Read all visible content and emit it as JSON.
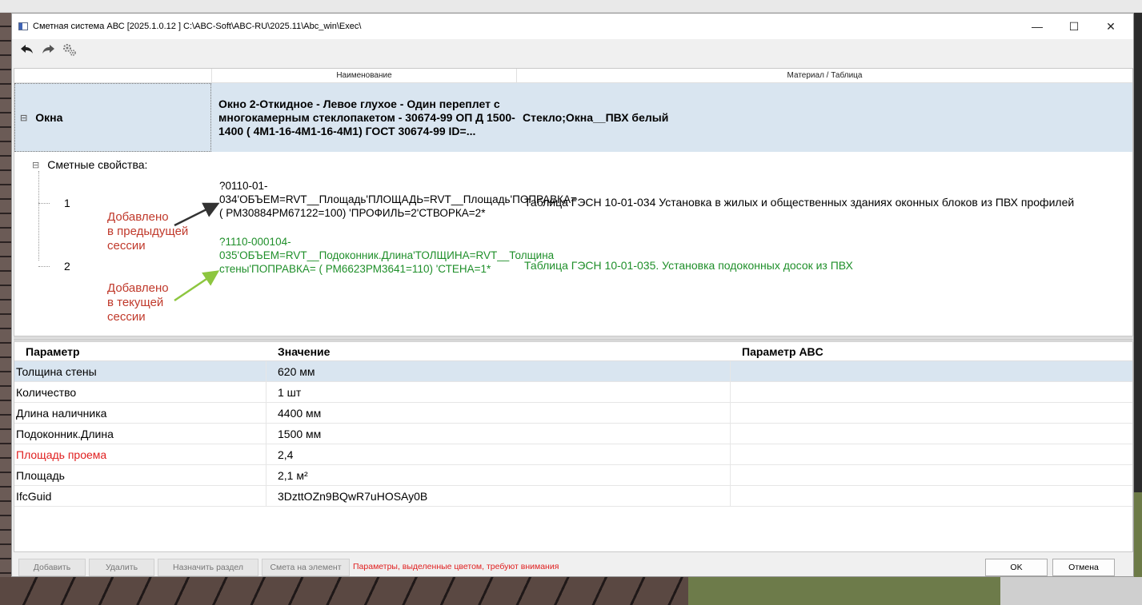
{
  "window": {
    "title": "Сметная система АВС [2025.1.0.12 ]  C:\\ABC-Soft\\ABC-RU\\2025.11\\Abc_win\\Exec\\",
    "minimize_glyph": "—",
    "maximize_glyph": "☐",
    "close_glyph": "✕"
  },
  "toolbar": {
    "icons": [
      "undo-icon",
      "redo-icon",
      "gears-icon"
    ]
  },
  "tree": {
    "columns": [
      "",
      "Наименование",
      "Материал / Таблица"
    ],
    "element": {
      "category": "Окна",
      "name": "Окно 2-Откидное - Левое глухое - Один переплет с многокамерным стеклопакетом - 30674-99 ОП Д  1500-1400  ( 4М1-16-4М1-16-4М1)    ГОСТ 30674-99  ID=...",
      "material": "Стекло;Окна__ПВХ белый"
    },
    "props_label": "Сметные свойства:",
    "items": [
      {
        "index": "1",
        "formula": "?0110-01-034'ОБЪЕМ=RVT__Площадь'ПЛОЩАДЬ=RVT__Площадь'ПОПРАВКА= ( РМ30884РМ67122=100)  'ПРОФИЛЬ=2'СТВОРКА=2*",
        "table": "Таблица ГЭСН 10-01-034 Установка в жилых и общественных зданиях оконных блоков из ПВХ профилей"
      },
      {
        "index": "2",
        "formula": "?1110-000104-035'ОБЪЕМ=RVT__Подоконник.Длина'ТОЛЩИНА=RVT__Толщина стены'ПОПРАВКА= ( РМ6623РМ3641=110)  'СТЕНА=1*",
        "table": "Таблица ГЭСН 10-01-035. Установка подоконных досок из ПВХ"
      }
    ],
    "annotations": {
      "previous": "Добавлено\nв предыдущей\nсессии",
      "current": "Добавлено\nв текущей\nсессии"
    }
  },
  "params": {
    "headers": [
      "Параметр",
      "Значение",
      "Параметр ABC"
    ],
    "rows": [
      {
        "name": "Толщина стены",
        "value": "620  мм",
        "abc": ""
      },
      {
        "name": "Количество",
        "value": "1  шт",
        "abc": ""
      },
      {
        "name": "Длина наличника",
        "value": "4400  мм",
        "abc": ""
      },
      {
        "name": "Подоконник.Длина",
        "value": "1500  мм",
        "abc": ""
      },
      {
        "name": "Площадь проема",
        "value": "2,4",
        "abc": ""
      },
      {
        "name": "Площадь",
        "value": "2,1  м²",
        "abc": ""
      },
      {
        "name": "IfcGuid",
        "value": "3DzttOZn9BQwR7uHOSAy0B",
        "abc": ""
      }
    ]
  },
  "footer": {
    "add": "Добавить",
    "delete": "Удалить",
    "assign_section": "Назначить раздел",
    "estimate": "Смета на элемент",
    "warning": "Параметры, выделенные цветом, требуют внимания",
    "ok": "OK",
    "cancel": "Отмена"
  },
  "colors": {
    "selection": "#d9e5f0",
    "warning": "#e02020",
    "new_item": "#1f8f2a",
    "annotation": "#c0392b",
    "arrow_prev": "#333333",
    "arrow_curr": "#8dc63f"
  }
}
